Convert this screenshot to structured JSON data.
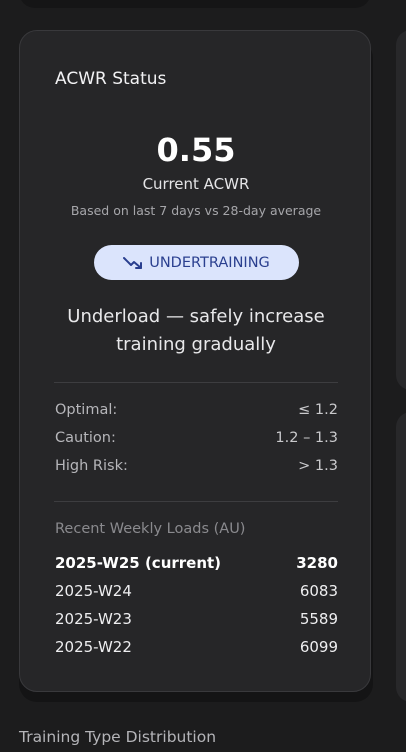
{
  "card": {
    "title": "ACWR Status",
    "acwr_value": "0.55",
    "acwr_label": "Current ACWR",
    "acwr_basis": "Based on last 7 days vs 28-day average",
    "status_badge": {
      "label": "UNDERTRAINING",
      "icon": "trending-down-icon",
      "bg_color": "#dbe4fc",
      "text_color": "#2a3f8f"
    },
    "status_message": "Underload — safely increase training gradually",
    "thresholds": [
      {
        "label": "Optimal:",
        "value": "≤ 1.2"
      },
      {
        "label": "Caution:",
        "value": "1.2 – 1.3"
      },
      {
        "label": "High Risk:",
        "value": "> 1.3"
      }
    ],
    "weekly_loads_title": "Recent Weekly Loads (AU)",
    "weekly_loads": [
      {
        "week": "2025-W25 (current)",
        "value": "3280",
        "current": true
      },
      {
        "week": "2025-W24",
        "value": "6083"
      },
      {
        "week": "2025-W23",
        "value": "5589"
      },
      {
        "week": "2025-W22",
        "value": "6099"
      }
    ]
  },
  "next_section_title": "Training Type Distribution"
}
